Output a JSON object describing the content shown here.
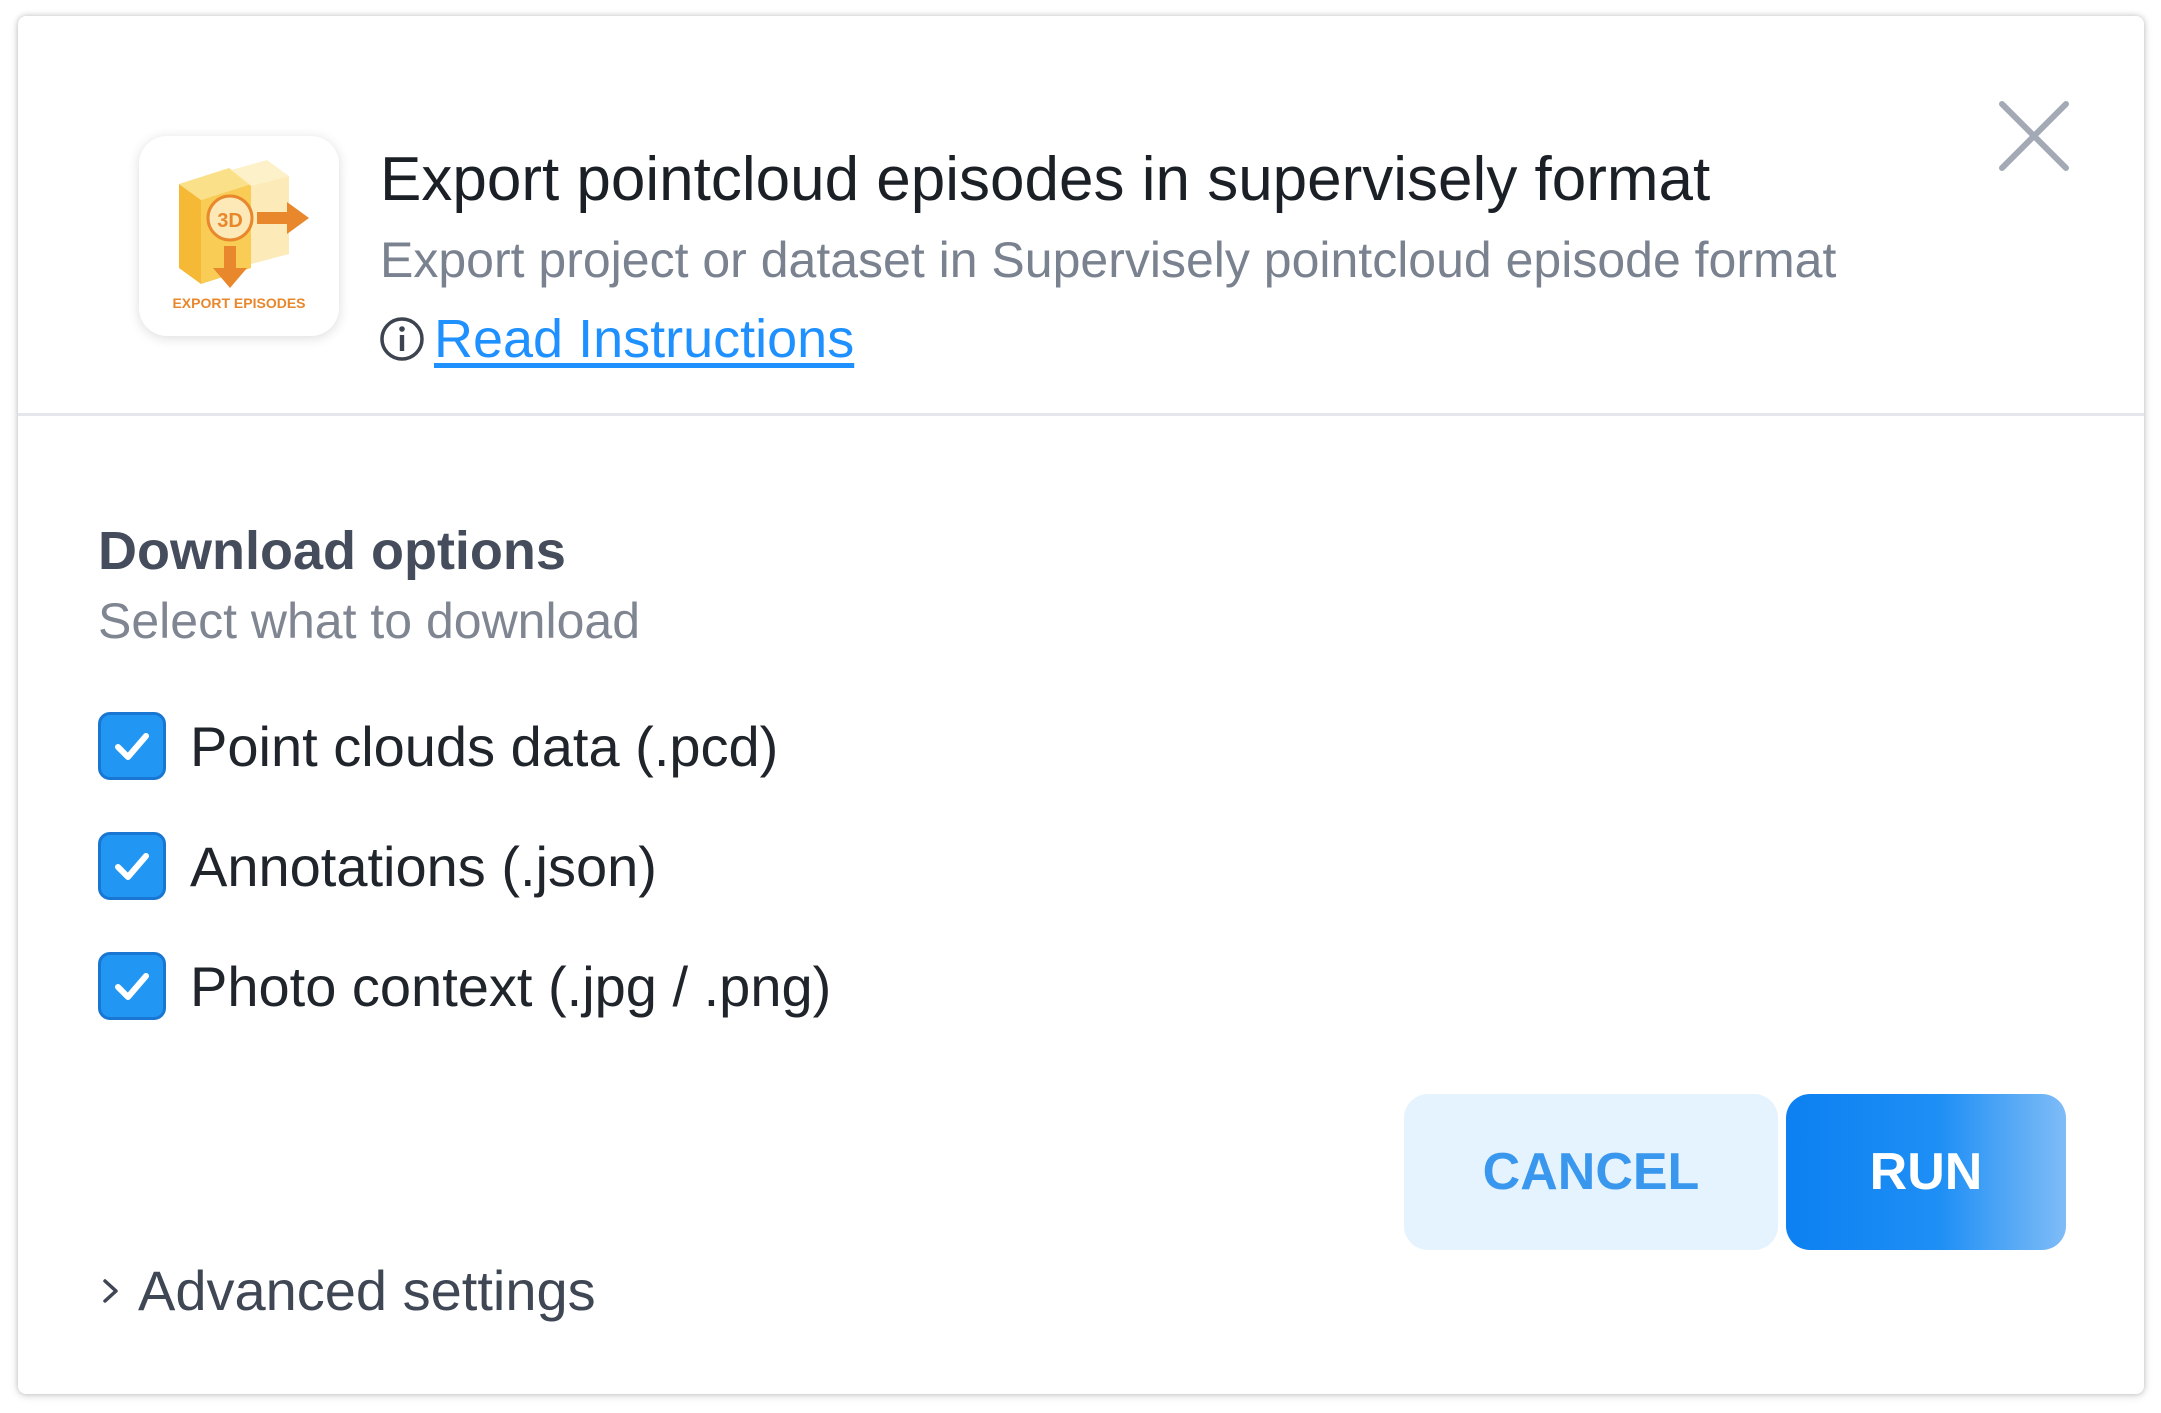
{
  "app": {
    "title": "Export pointcloud episodes in supervisely format",
    "subtitle": "Export project or dataset in Supervisely pointcloud episode format",
    "instructions_label": "Read Instructions",
    "icon": {
      "badge_text": "3D",
      "caption": "EXPORT EPISODES",
      "accent_color": "#e8872c",
      "cube_color": "#f5c44b"
    }
  },
  "download_options": {
    "title": "Download options",
    "subtitle": "Select what to download",
    "items": [
      {
        "label": "Point clouds data (.pcd)",
        "checked": true
      },
      {
        "label": "Annotations (.json)",
        "checked": true
      },
      {
        "label": "Photo context (.jpg / .png)",
        "checked": true
      }
    ]
  },
  "buttons": {
    "cancel": "CANCEL",
    "run": "RUN"
  },
  "advanced": {
    "label": "Advanced settings",
    "expanded": false
  },
  "colors": {
    "primary": "#1e90ff",
    "checkbox": "#2196f3",
    "cancel_bg": "#e4f3fe",
    "cancel_text": "#3a97ee"
  }
}
